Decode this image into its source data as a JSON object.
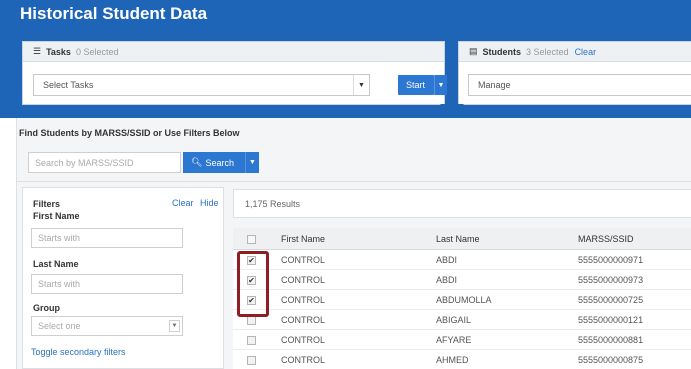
{
  "page": {
    "title": "Historical Student Data"
  },
  "tasks_panel": {
    "title": "Tasks",
    "count": "0 Selected",
    "select_value": "Select Tasks",
    "start_label": "Start"
  },
  "students_panel": {
    "title": "Students",
    "count": "3 Selected",
    "clear_label": "Clear",
    "manage_value": "Manage"
  },
  "find": {
    "label": "Find Students by MARSS/SSID or Use Filters Below",
    "search_placeholder": "Search by MARSS/SSID",
    "search_button": "Search"
  },
  "filters": {
    "title": "Filters",
    "clear": "Clear",
    "hide": "Hide",
    "first_name_label": "First Name",
    "first_name_placeholder": "Starts with",
    "last_name_label": "Last Name",
    "last_name_placeholder": "Starts with",
    "group_label": "Group",
    "group_placeholder": "Select one",
    "toggle_secondary": "Toggle secondary filters"
  },
  "results": {
    "count_text": "1,175 Results",
    "columns": [
      "First Name",
      "Last Name",
      "MARSS/SSID"
    ],
    "rows": [
      {
        "checked": true,
        "first": "CONTROL",
        "last": "ABDI",
        "id": "5555000000971"
      },
      {
        "checked": true,
        "first": "CONTROL",
        "last": "ABDI",
        "id": "5555000000973"
      },
      {
        "checked": true,
        "first": "CONTROL",
        "last": "ABDUMOLLA",
        "id": "5555000000725"
      },
      {
        "checked": false,
        "first": "CONTROL",
        "last": "ABIGAIL",
        "id": "5555000000121"
      },
      {
        "checked": false,
        "first": "CONTROL",
        "last": "AFYARE",
        "id": "5555000000881"
      },
      {
        "checked": false,
        "first": "CONTROL",
        "last": "AHMED",
        "id": "5555000000875"
      }
    ]
  },
  "icons": {
    "tasks_icon": "list-icon",
    "students_icon": "id-card-icon",
    "search_icon": "search-icon",
    "caret_icon": "chevron-down-icon",
    "checkmark": "✔"
  },
  "colors": {
    "header_blue": "#1f65b7",
    "button_blue": "#2b77d1",
    "link_blue": "#2a72c3",
    "highlight_red": "#8f1d24"
  }
}
